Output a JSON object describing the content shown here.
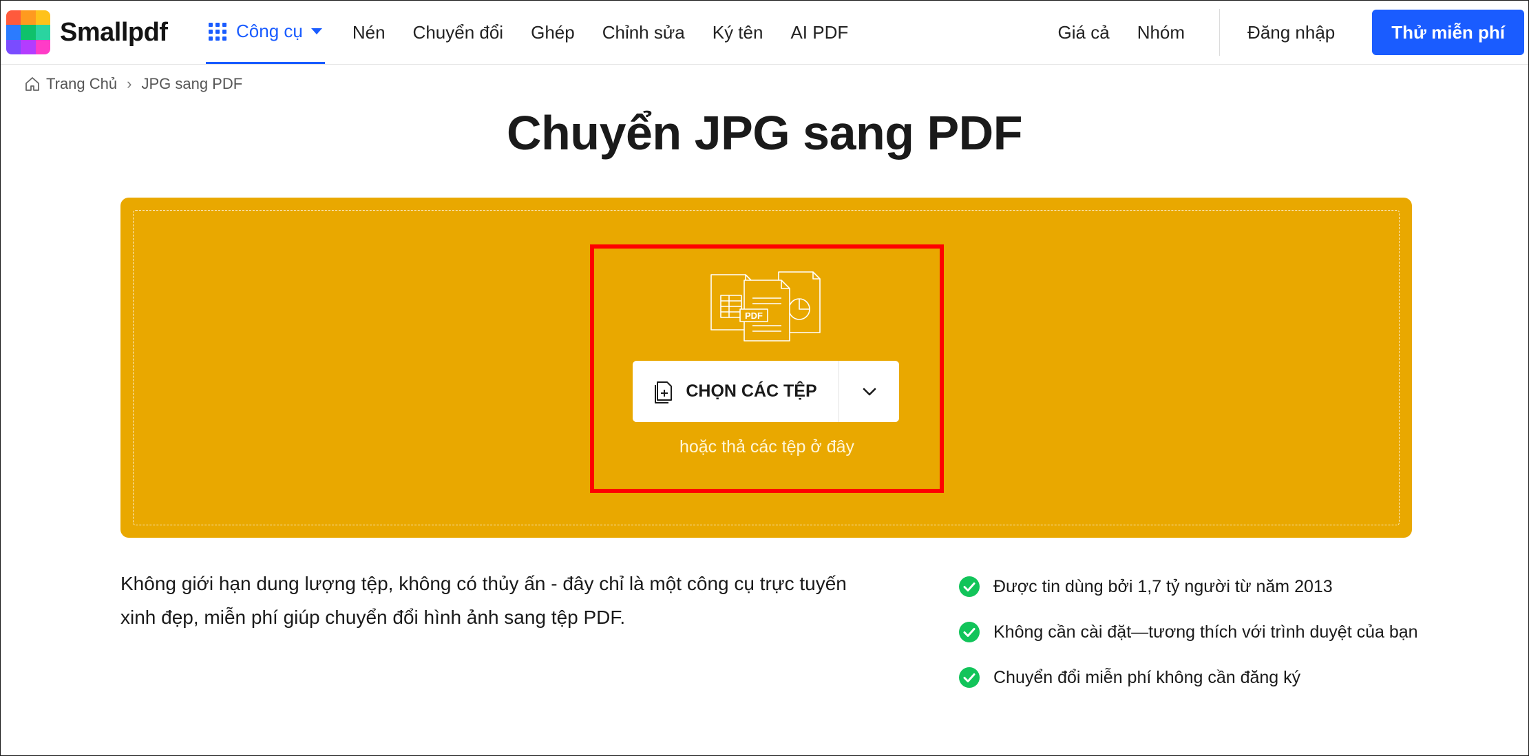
{
  "brand": {
    "name": "Smallpdf",
    "logo_colors": [
      "#ff5a3c",
      "#ff9a1f",
      "#ffc21a",
      "#2b7bff",
      "#0fc16b",
      "#2ad4a0",
      "#7a4cff",
      "#b33cff",
      "#ff3cc7"
    ]
  },
  "nav": {
    "tools_label": "Công cụ",
    "links": [
      "Nén",
      "Chuyển đổi",
      "Ghép",
      "Chỉnh sửa",
      "Ký tên",
      "AI PDF"
    ],
    "right_links": [
      "Giá cả",
      "Nhóm"
    ],
    "login": "Đăng nhập",
    "cta": "Thử miễn phí"
  },
  "breadcrumb": {
    "home": "Trang Chủ",
    "separator": "›",
    "current": "JPG sang PDF"
  },
  "page": {
    "title": "Chuyển JPG sang PDF"
  },
  "dropzone": {
    "background": "#e9a800",
    "choose_label": "CHỌN CÁC TỆP",
    "hint": "hoặc thả các tệp ở đây",
    "illustration_label": "PDF"
  },
  "description": "Không giới hạn dung lượng tệp, không có thủy ấn - đây chỉ là một công cụ trực tuyến xinh đẹp, miễn phí giúp chuyển đổi hình ảnh sang tệp PDF.",
  "features": [
    "Được tin dùng bởi 1,7 tỷ người từ năm 2013",
    "Không cần cài đặt—tương thích với trình duyệt của bạn",
    "Chuyển đổi miễn phí không cần đăng ký"
  ],
  "colors": {
    "accent": "#1a5cff",
    "check": "#12c45a",
    "highlight": "#ff0000"
  }
}
